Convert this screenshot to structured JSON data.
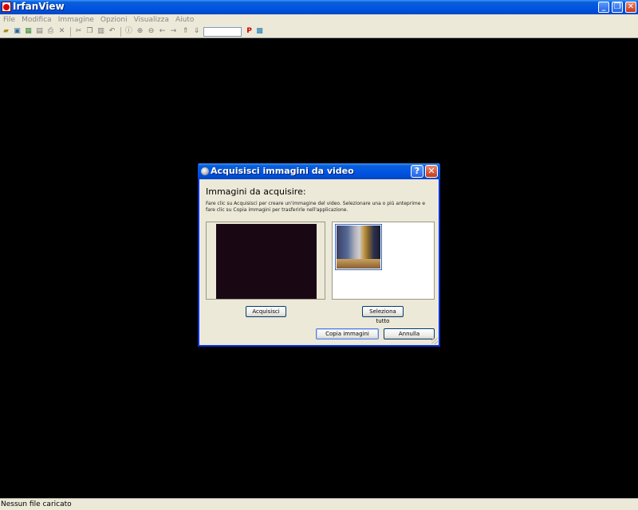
{
  "app": {
    "title": "IrfanView",
    "window_buttons": {
      "minimize": "_",
      "restore": "❐",
      "close": "✕"
    }
  },
  "menu": [
    "File",
    "Modifica",
    "Immagine",
    "Opzioni",
    "Visualizza",
    "Aiuto"
  ],
  "toolbar": {
    "icons": [
      "open-folder-icon",
      "thumbnails-icon",
      "grid-icon",
      "save-icon",
      "print-icon",
      "delete-icon",
      "cut-icon",
      "copy-icon",
      "paste-icon",
      "undo-icon",
      "info-icon",
      "zoom-in-icon",
      "zoom-out-icon",
      "previous-icon",
      "next-icon",
      "first-icon",
      "last-icon"
    ],
    "input_value": "",
    "p_label": "P"
  },
  "statusbar": {
    "text": "Nessun file caricato"
  },
  "dialog": {
    "title": "Acquisisci immagini da video",
    "help": "?",
    "close": "✕",
    "heading": "Immagini da acquisire:",
    "description": "Fare clic su Acquisisci per creare un'immagine del video. Selezionare una o più anteprime e fare clic su Copia immagini per trasferirle nell'applicazione.",
    "acquire_label": "Acquisisci",
    "select_all_label": "Seleziona tutto",
    "copy_label": "Copia immagini",
    "cancel_label": "Annulla"
  },
  "colors": {
    "titlebar": "#0053e1",
    "chrome": "#ece9d8",
    "canvas": "#000000"
  }
}
